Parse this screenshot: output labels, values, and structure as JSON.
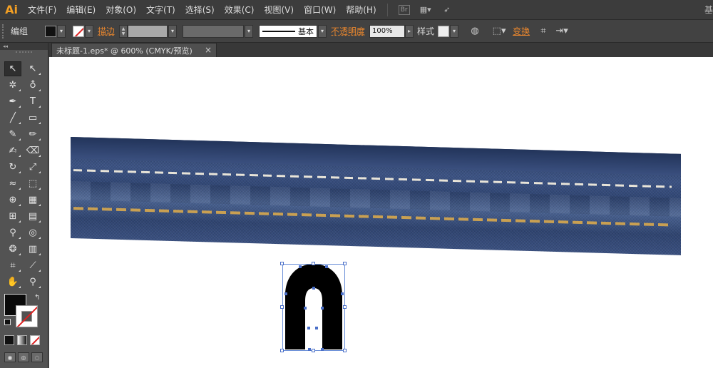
{
  "app": {
    "logo": "Ai"
  },
  "menu": {
    "items": [
      "文件(F)",
      "编辑(E)",
      "对象(O)",
      "文字(T)",
      "选择(S)",
      "效果(C)",
      "视图(V)",
      "窗口(W)",
      "帮助(H)"
    ],
    "bridge_label": "Br",
    "right_text": "基"
  },
  "control": {
    "selection_label": "编组",
    "stroke_label": "描边",
    "stroke_style_label": "基本",
    "opacity_label": "不透明度",
    "opacity_value": "100%",
    "style_label": "样式",
    "transform_label": "变换"
  },
  "document": {
    "tab_title": "未标题-1.eps* @ 600% (CMYK/预览)",
    "close_glyph": "×"
  },
  "toolbox": {
    "collapse_glyph": "◂◂",
    "tools": [
      {
        "name": "selection-tool",
        "glyph": "↖",
        "active": true
      },
      {
        "name": "direct-selection-tool",
        "glyph": "↖",
        "active": false
      },
      {
        "name": "magic-wand-tool",
        "glyph": "✲",
        "active": false
      },
      {
        "name": "lasso-tool",
        "glyph": "♁",
        "active": false
      },
      {
        "name": "pen-tool",
        "glyph": "✒",
        "active": false
      },
      {
        "name": "type-tool",
        "glyph": "T",
        "active": false
      },
      {
        "name": "line-segment-tool",
        "glyph": "╱",
        "active": false
      },
      {
        "name": "rectangle-tool",
        "glyph": "▭",
        "active": false
      },
      {
        "name": "paintbrush-tool",
        "glyph": "✎",
        "active": false
      },
      {
        "name": "pencil-tool",
        "glyph": "✏",
        "active": false
      },
      {
        "name": "blob-brush-tool",
        "glyph": "✍",
        "active": false
      },
      {
        "name": "eraser-tool",
        "glyph": "⌫",
        "active": false
      },
      {
        "name": "rotate-tool",
        "glyph": "↻",
        "active": false
      },
      {
        "name": "scale-tool",
        "glyph": "⤢",
        "active": false
      },
      {
        "name": "width-tool",
        "glyph": "≈",
        "active": false
      },
      {
        "name": "free-transform-tool",
        "glyph": "⬚",
        "active": false
      },
      {
        "name": "shape-builder-tool",
        "glyph": "⊕",
        "active": false
      },
      {
        "name": "perspective-grid-tool",
        "glyph": "▦",
        "active": false
      },
      {
        "name": "mesh-tool",
        "glyph": "⊞",
        "active": false
      },
      {
        "name": "gradient-tool",
        "glyph": "▤",
        "active": false
      },
      {
        "name": "eyedropper-tool",
        "glyph": "⚲",
        "active": false
      },
      {
        "name": "blend-tool",
        "glyph": "◎",
        "active": false
      },
      {
        "name": "symbol-sprayer-tool",
        "glyph": "❂",
        "active": false
      },
      {
        "name": "column-graph-tool",
        "glyph": "▥",
        "active": false
      },
      {
        "name": "artboard-tool",
        "glyph": "⌗",
        "active": false
      },
      {
        "name": "slice-tool",
        "glyph": "⟋",
        "active": false
      },
      {
        "name": "hand-tool",
        "glyph": "✋",
        "active": false
      },
      {
        "name": "zoom-tool",
        "glyph": "⚲",
        "active": false
      }
    ],
    "fill_color": "#0a0a0a",
    "stroke_color": "none"
  },
  "colors": {
    "accent_orange": "#e8862e",
    "selection_blue": "#4a6fc8",
    "canvas_bg": "#ffffff",
    "denim_blue": "#3c5384",
    "stitch_gold": "#c9a052"
  },
  "canvas": {
    "denim_image": "denim-strip-with-stitching",
    "selected_shape": "black-arch-shape"
  }
}
